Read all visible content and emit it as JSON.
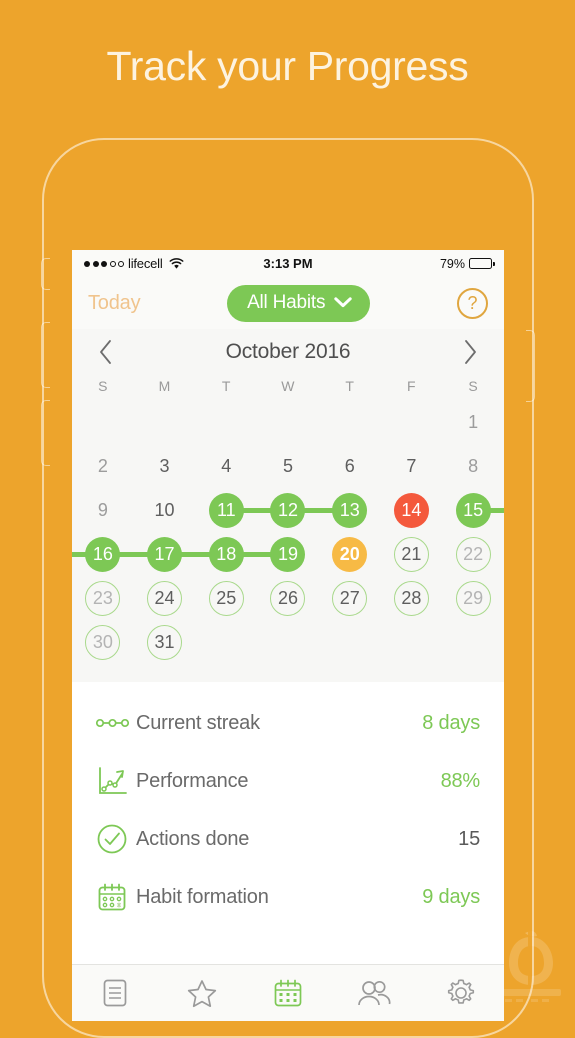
{
  "headline": "Track your Progress",
  "statusbar": {
    "carrier": "lifecell",
    "signal_dots_filled": 3,
    "signal_dots_total": 5,
    "wifi_icon": "wifi-icon",
    "time": "3:13 PM",
    "battery_percent": "79%",
    "battery_level": 79
  },
  "navbar": {
    "today_label": "Today",
    "filter_label": "All Habits",
    "filter_chevron_icon": "chevron-down-icon",
    "help_label": "?"
  },
  "monthbar": {
    "prev_icon": "chevron-left-icon",
    "title": "October 2016",
    "next_icon": "chevron-right-icon"
  },
  "calendar": {
    "day_headers": [
      "S",
      "M",
      "T",
      "W",
      "T",
      "F",
      "S"
    ],
    "weeks": [
      [
        {
          "label": "",
          "state": "empty"
        },
        {
          "label": "",
          "state": "empty"
        },
        {
          "label": "",
          "state": "empty"
        },
        {
          "label": "",
          "state": "empty"
        },
        {
          "label": "",
          "state": "empty"
        },
        {
          "label": "",
          "state": "empty"
        },
        {
          "label": "1",
          "state": "plain"
        }
      ],
      [
        {
          "label": "2",
          "state": "plain"
        },
        {
          "label": "3",
          "state": "plain-dark"
        },
        {
          "label": "4",
          "state": "plain-dark"
        },
        {
          "label": "5",
          "state": "plain-dark"
        },
        {
          "label": "6",
          "state": "plain-dark"
        },
        {
          "label": "7",
          "state": "plain-dark"
        },
        {
          "label": "8",
          "state": "plain"
        }
      ],
      [
        {
          "label": "9",
          "state": "plain"
        },
        {
          "label": "10",
          "state": "plain-dark"
        },
        {
          "label": "11",
          "state": "done"
        },
        {
          "label": "12",
          "state": "done"
        },
        {
          "label": "13",
          "state": "done"
        },
        {
          "label": "14",
          "state": "missed"
        },
        {
          "label": "15",
          "state": "done"
        }
      ],
      [
        {
          "label": "16",
          "state": "done"
        },
        {
          "label": "17",
          "state": "done"
        },
        {
          "label": "18",
          "state": "done"
        },
        {
          "label": "19",
          "state": "done"
        },
        {
          "label": "20",
          "state": "today"
        },
        {
          "label": "21",
          "state": "ring"
        },
        {
          "label": "22",
          "state": "ring-light"
        }
      ],
      [
        {
          "label": "23",
          "state": "ring-light"
        },
        {
          "label": "24",
          "state": "ring"
        },
        {
          "label": "25",
          "state": "ring"
        },
        {
          "label": "26",
          "state": "ring"
        },
        {
          "label": "27",
          "state": "ring"
        },
        {
          "label": "28",
          "state": "ring"
        },
        {
          "label": "29",
          "state": "ring-light"
        }
      ],
      [
        {
          "label": "30",
          "state": "ring-light"
        },
        {
          "label": "31",
          "state": "ring"
        },
        {
          "label": "",
          "state": "empty"
        },
        {
          "label": "",
          "state": "empty"
        },
        {
          "label": "",
          "state": "empty"
        },
        {
          "label": "",
          "state": "empty"
        },
        {
          "label": "",
          "state": "empty"
        }
      ]
    ],
    "streak_links": [
      {
        "week": 2,
        "from": 2,
        "to": 4,
        "note": "11-12-13"
      },
      {
        "week": 2,
        "from": 6,
        "to": 7,
        "note": "15 to row edge"
      },
      {
        "week": 3,
        "from": 0,
        "to": 3,
        "note": "row edge to 16-17-18-19"
      }
    ]
  },
  "stats": [
    {
      "icon": "streak-chain-icon",
      "label": "Current streak",
      "value": "8 days",
      "value_color": "green"
    },
    {
      "icon": "line-chart-icon",
      "label": "Performance",
      "value": "88%",
      "value_color": "green"
    },
    {
      "icon": "check-circle-icon",
      "label": "Actions done",
      "value": "15",
      "value_color": "neutral"
    },
    {
      "icon": "calendar-icon",
      "label": "Habit formation",
      "value": "9 days",
      "value_color": "green"
    }
  ],
  "tabbar": [
    {
      "icon": "list-icon",
      "name": "tab-list",
      "active": false
    },
    {
      "icon": "star-icon",
      "name": "tab-favorites",
      "active": false
    },
    {
      "icon": "calendar-icon",
      "name": "tab-calendar",
      "active": true
    },
    {
      "icon": "people-icon",
      "name": "tab-community",
      "active": false
    },
    {
      "icon": "gear-icon",
      "name": "tab-settings",
      "active": false
    }
  ],
  "colors": {
    "background": "#eda42c",
    "green": "#7dc855",
    "red": "#f4593c",
    "yellow": "#f7ba45",
    "ring": "#a9d98c",
    "accent_orange": "#e0a63f"
  }
}
